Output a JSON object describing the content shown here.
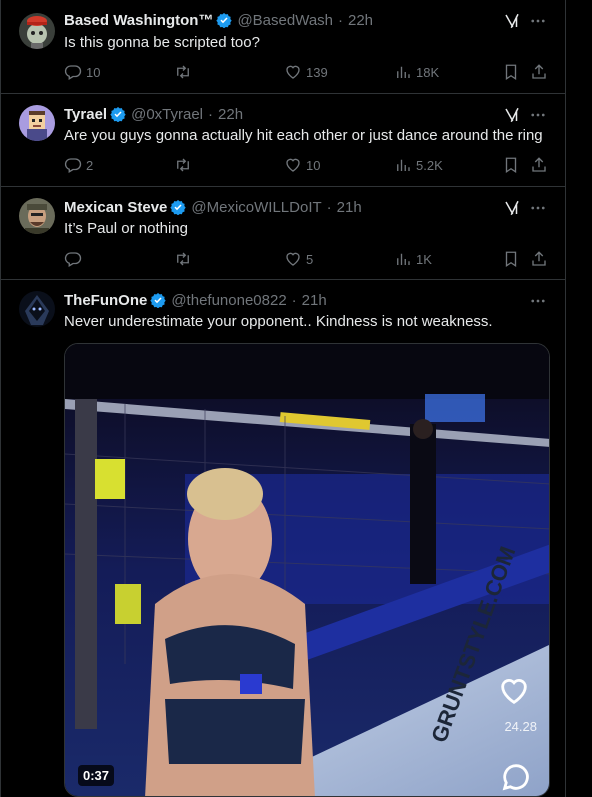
{
  "tweets": [
    {
      "name": "Based Washington™",
      "handle": "@BasedWash",
      "time": "22h",
      "text": "Is this gonna be scripted too?",
      "replies": "10",
      "reposts": "",
      "likes": "139",
      "views": "18K"
    },
    {
      "name": "Tyrael",
      "handle": "@0xTyrael",
      "time": "22h",
      "text": "Are you guys gonna actually hit each other or just dance around the ring",
      "replies": "2",
      "reposts": "",
      "likes": "10",
      "views": "5.2K"
    },
    {
      "name": "Mexican Steve",
      "handle": "@MexicoWILLDoIT",
      "time": "21h",
      "text": "It’s Paul or nothing",
      "replies": "",
      "reposts": "",
      "likes": "5",
      "views": "1K"
    },
    {
      "name": "TheFunOne",
      "handle": "@thefunone0822",
      "time": "21h",
      "text": "Never underestimate your opponent.. Kindness is not weakness.",
      "video": {
        "duration": "0:37",
        "overlay_count": "24.28",
        "cage_text": "GRUNTSTYLE.COM"
      }
    }
  ],
  "separator": "·",
  "colors": {
    "verified": "#1d9bf0",
    "muted": "#71767b",
    "border": "#2f3336"
  }
}
